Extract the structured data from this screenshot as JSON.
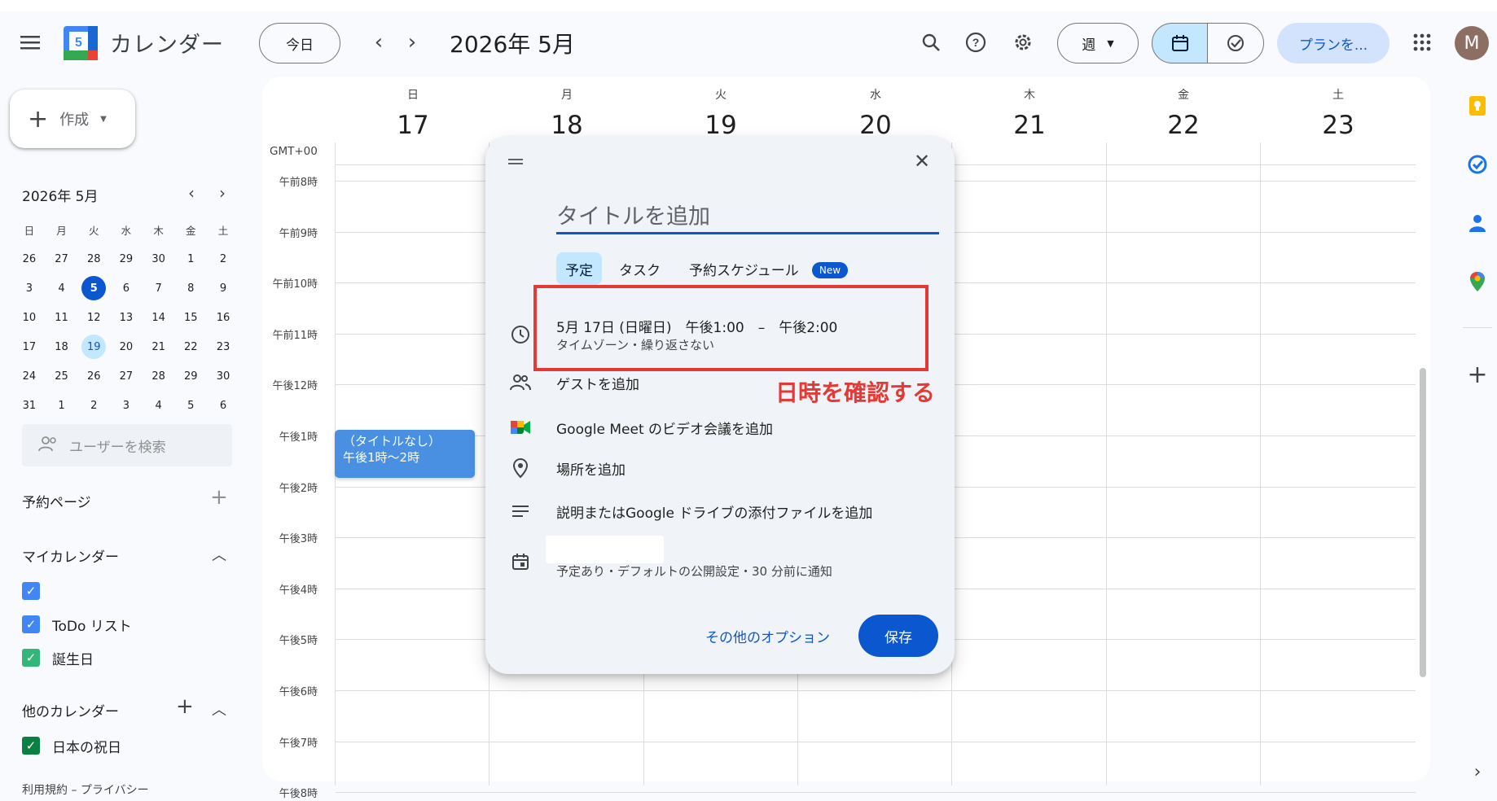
{
  "app": {
    "title": "カレンダー",
    "logo_number": "5"
  },
  "header": {
    "today_label": "今日",
    "period": "2026年 5月",
    "view_label": "週",
    "plan_label": "プランを...",
    "avatar_letter": "M"
  },
  "sidebar": {
    "create_label": "作成",
    "mini_calendar": {
      "title": "2026年 5月",
      "weekdays": [
        "日",
        "月",
        "火",
        "水",
        "木",
        "金",
        "土"
      ],
      "weeks": [
        [
          "26",
          "27",
          "28",
          "29",
          "30",
          "1",
          "2"
        ],
        [
          "3",
          "4",
          "5",
          "6",
          "7",
          "8",
          "9"
        ],
        [
          "10",
          "11",
          "12",
          "13",
          "14",
          "15",
          "16"
        ],
        [
          "17",
          "18",
          "19",
          "20",
          "21",
          "22",
          "23"
        ],
        [
          "24",
          "25",
          "26",
          "27",
          "28",
          "29",
          "30"
        ],
        [
          "31",
          "1",
          "2",
          "3",
          "4",
          "5",
          "6"
        ]
      ],
      "today": "5",
      "selected": "19"
    },
    "user_search_placeholder": "ユーザーを検索",
    "booking_pages_label": "予約ページ",
    "my_calendars_label": "マイカレンダー",
    "my_calendars": [
      {
        "label": "",
        "color": "#4285f4"
      },
      {
        "label": "ToDo リスト",
        "color": "#4285f4"
      },
      {
        "label": "誕生日",
        "color": "#33b679"
      }
    ],
    "other_calendars_label": "他のカレンダー",
    "other_calendars": [
      {
        "label": "日本の祝日",
        "color": "#0b8043"
      }
    ],
    "footer": "利用規約 – プライバシー"
  },
  "week": {
    "timezone": "GMT+00",
    "days": [
      {
        "dow": "日",
        "num": "17"
      },
      {
        "dow": "月",
        "num": "18"
      },
      {
        "dow": "火",
        "num": "19"
      },
      {
        "dow": "水",
        "num": "20"
      },
      {
        "dow": "木",
        "num": "21"
      },
      {
        "dow": "金",
        "num": "22"
      },
      {
        "dow": "土",
        "num": "23"
      }
    ],
    "hours": [
      "午前8時",
      "午前9時",
      "午前10時",
      "午前11時",
      "午後12時",
      "午後1時",
      "午後2時",
      "午後3時",
      "午後4時",
      "午後5時",
      "午後6時",
      "午後7時",
      "午後8時"
    ],
    "event": {
      "title": "（タイトルなし）",
      "time": "午後1時～2時"
    }
  },
  "dialog": {
    "title_placeholder": "タイトルを追加",
    "tabs": [
      "予定",
      "タスク",
      "予約スケジュール"
    ],
    "new_badge": "New",
    "datetime": "5月 17日 (日曜日)　午後1:00　–　午後2:00",
    "datetime_sub": "タイムゾーン・繰り返さない",
    "guests": "ゲストを追加",
    "meet": "Google Meet のビデオ会議を追加",
    "location": "場所を追加",
    "description": "説明またはGoogle ドライブの添付ファイルを追加",
    "calendar_info": "予定あり・デフォルトの公開設定・30 分前に通知",
    "more_options": "その他のオプション",
    "save": "保存"
  },
  "annotation": {
    "text": "日時を確認する",
    "color": "#e53935"
  },
  "colors": {
    "accent": "#0b57d0",
    "event": "#4a90e2",
    "today": "#0b57d0"
  }
}
